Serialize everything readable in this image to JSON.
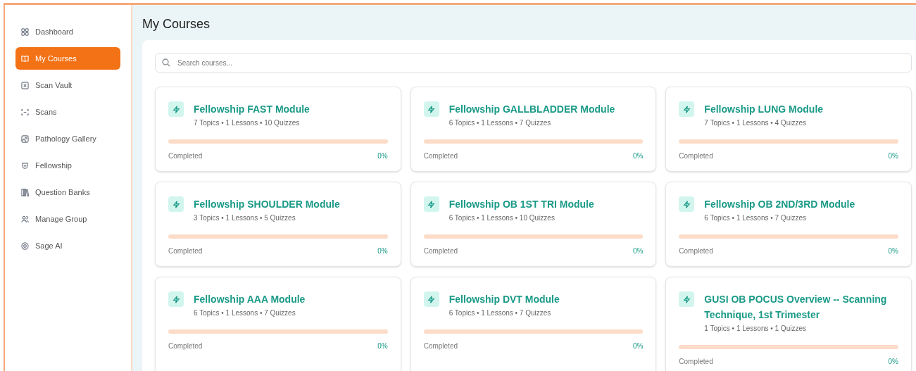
{
  "sidebar": {
    "items": [
      {
        "label": "Dashboard",
        "selected": false
      },
      {
        "label": "My Courses",
        "selected": true
      },
      {
        "label": "Scan Vault",
        "selected": false
      },
      {
        "label": "Scans",
        "selected": false
      },
      {
        "label": "Pathology Gallery",
        "selected": false
      },
      {
        "label": "Fellowship",
        "selected": false
      },
      {
        "label": "Question Banks",
        "selected": false
      },
      {
        "label": "Manage Group",
        "selected": false
      },
      {
        "label": "Sage AI",
        "selected": false
      }
    ]
  },
  "page_title": "My Courses",
  "search": {
    "placeholder": "Search courses..."
  },
  "courses": [
    {
      "title": "Fellowship FAST Module",
      "meta": "7 Topics • 1 Lessons • 10 Quizzes",
      "status": "Completed",
      "level": 0,
      "percent": "0%"
    },
    {
      "title": "Fellowship GALLBLADDER Module",
      "meta": "6 Topics • 1 Lessons • 7 Quizzes",
      "status": "Completed",
      "level": 0,
      "percent": "0%"
    },
    {
      "title": "Fellowship LUNG Module",
      "meta": "7 Topics • 1 Lessons • 4 Quizzes",
      "status": "Completed",
      "level": 0,
      "percent": "0%"
    },
    {
      "title": "Fellowship SHOULDER Module",
      "meta": "3 Topics • 1 Lessons • 5 Quizzes",
      "status": "Completed",
      "level": 0,
      "percent": "0%"
    },
    {
      "title": "Fellowship OB 1ST TRI Module",
      "meta": "6 Topics • 1 Lessons • 10 Quizzes",
      "status": "Completed",
      "level": 0,
      "percent": "0%"
    },
    {
      "title": "Fellowship OB 2ND/3RD Module",
      "meta": "6 Topics • 1 Lessons • 7 Quizzes",
      "status": "Completed",
      "level": 0,
      "percent": "0%"
    },
    {
      "title": "Fellowship AAA Module",
      "meta": "6 Topics • 1 Lessons • 7 Quizzes",
      "status": "Completed",
      "level": 0,
      "percent": "0%"
    },
    {
      "title": "Fellowship DVT Module",
      "meta": "6 Topics • 1 Lessons • 7 Quizzes",
      "status": "Completed",
      "level": 0,
      "percent": "0%"
    },
    {
      "title": "GUSI OB POCUS Overview -- Scanning Technique, 1st Trimester",
      "meta": "1 Topics • 1 Lessons • 1 Quizzes",
      "status": "Completed",
      "level": 0,
      "percent": "0%"
    }
  ]
}
